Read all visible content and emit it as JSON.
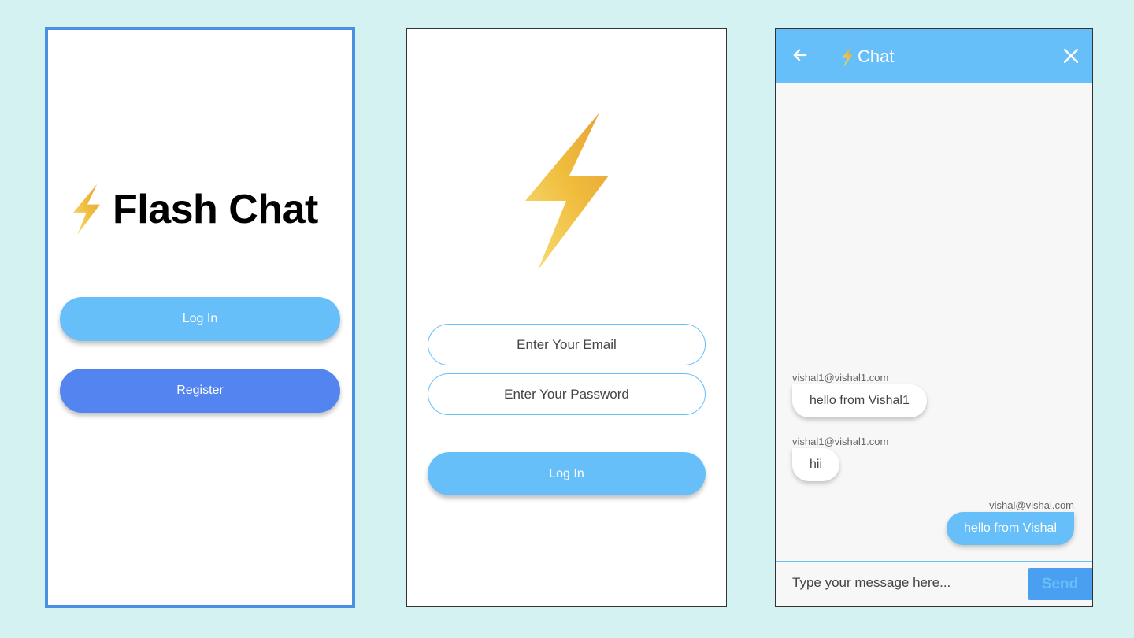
{
  "welcome": {
    "app_title": "Flash Chat",
    "login_label": "Log In",
    "register_label": "Register"
  },
  "login": {
    "email_placeholder": "Enter Your Email",
    "password_placeholder": "Enter Your Password",
    "login_label": "Log In"
  },
  "chat": {
    "title": "Chat",
    "messages": [
      {
        "sender": "vishal1@vishal1.com",
        "text": "hello from Vishal1",
        "is_me": false
      },
      {
        "sender": "vishal1@vishal1.com",
        "text": "hii",
        "is_me": false
      },
      {
        "sender": "vishal@vishal.com",
        "text": "hello from Vishal",
        "is_me": true
      }
    ],
    "input_placeholder": "Type your message here...",
    "send_label": "Send"
  },
  "colors": {
    "background": "#d4f2f2",
    "light_blue": "#66bff9",
    "register_blue": "#5484f0",
    "frame_blue": "#4a90e2",
    "bolt_gold": "#f0b73c"
  },
  "icons": [
    "lightning-bolt-icon",
    "back-arrow-icon",
    "close-icon"
  ]
}
